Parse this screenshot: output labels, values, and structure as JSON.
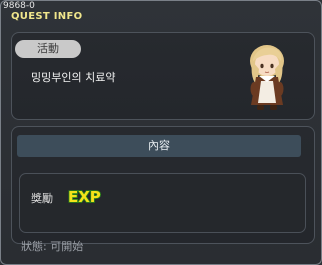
{
  "window": {
    "quest_id": "9868-0",
    "title": "QUEST INFO"
  },
  "quest": {
    "category_tag": "活動",
    "subject": "밍밍부인의 치료약"
  },
  "content": {
    "header": "內容",
    "reward_label": "獎勵",
    "reward_icon": "exp-icon",
    "reward_text": "EXP"
  },
  "status": {
    "text": "狀態: 可開始"
  },
  "colors": {
    "title": "#f0e68c",
    "exp_fill": "#f4e21a",
    "exp_outline": "#2a8a1a"
  }
}
